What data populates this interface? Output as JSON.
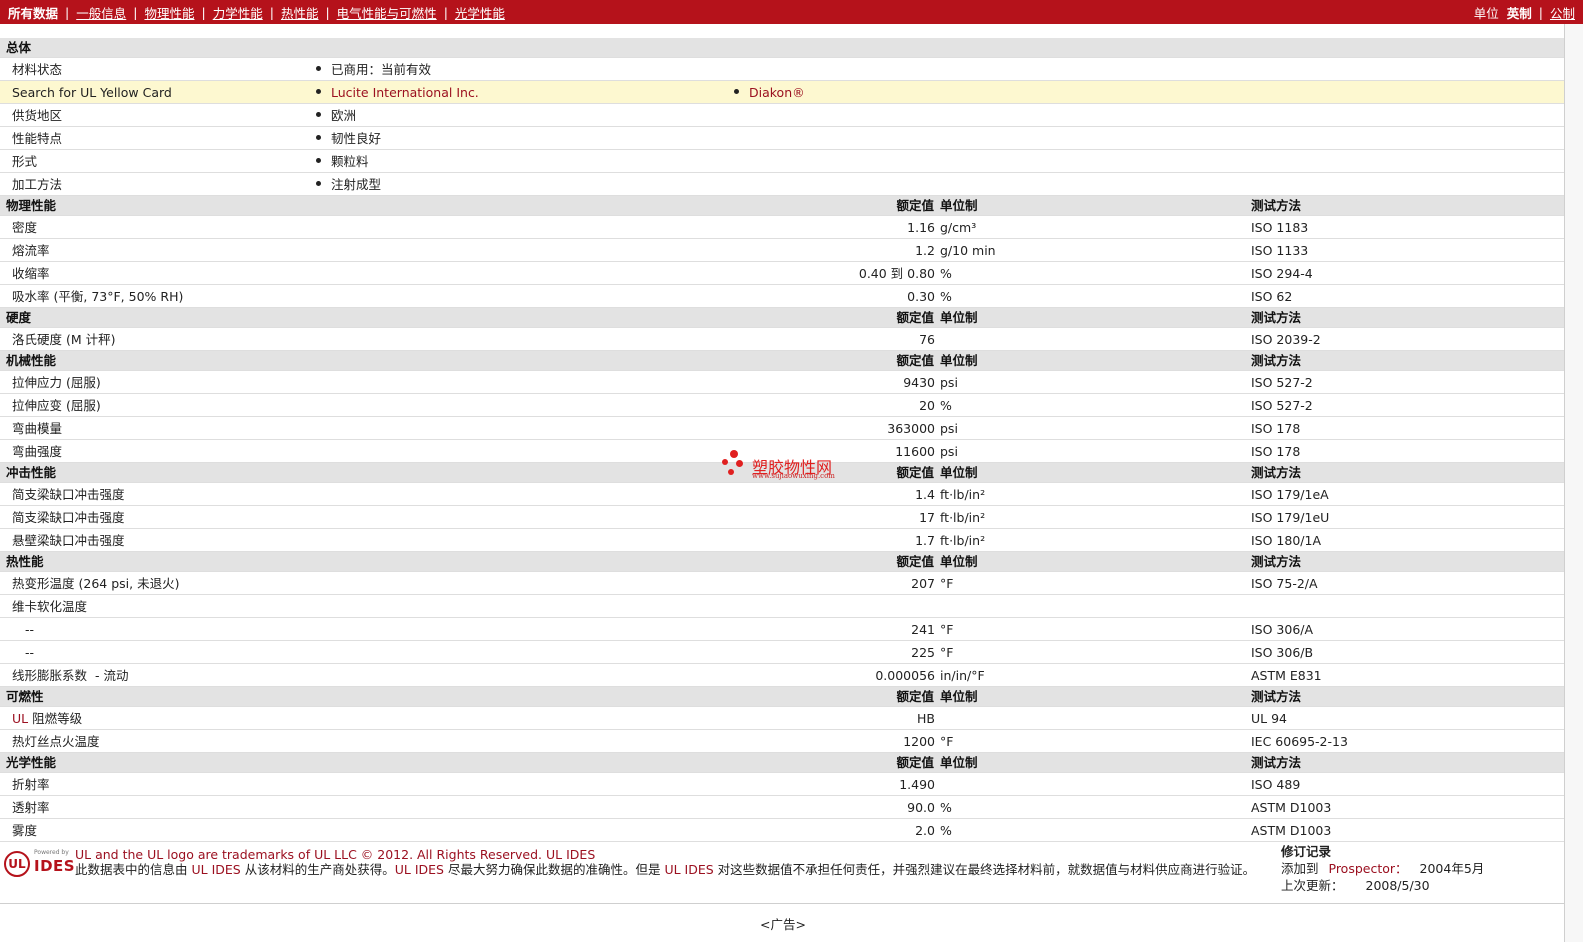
{
  "topbar": {
    "all_data": "所有数据",
    "nav": [
      "一般信息",
      "物理性能",
      "力学性能",
      "热性能",
      "电气性能与可燃性",
      "光学性能"
    ],
    "unit_label": "单位",
    "english": "英制",
    "metric": "公制",
    "sep": "|"
  },
  "general": {
    "title": "总体",
    "rows": [
      {
        "label": "材料状态",
        "v1": "已商用：当前有效",
        "v2": ""
      },
      {
        "label": "Search for UL Yellow Card",
        "v1": "Lucite International Inc.",
        "v2": "Diakon®"
      },
      {
        "label": "供货地区",
        "v1": "欧洲",
        "v2": ""
      },
      {
        "label": "性能特点",
        "v1": "韧性良好",
        "v2": ""
      },
      {
        "label": "形式",
        "v1": "颗粒料",
        "v2": ""
      },
      {
        "label": "加工方法",
        "v1": "注射成型",
        "v2": ""
      }
    ]
  },
  "columns": {
    "value": "额定值",
    "unit": "单位制",
    "test": "测试方法"
  },
  "sections": {
    "physical": {
      "title": "物理性能",
      "rows": [
        {
          "label": "密度",
          "label_extra": "",
          "value": "1.16",
          "unit": "g/cm³",
          "test": "ISO 1183"
        },
        {
          "label": "熔流率",
          "label_extra": "",
          "value": "1.2",
          "unit": "g/10 min",
          "test": "ISO 1133"
        },
        {
          "label": "收缩率",
          "label_extra": "",
          "value": "0.40 到 0.80",
          "unit": "%",
          "test": "ISO 294-4"
        },
        {
          "label": "吸水率",
          "label_extra": "(平衡, 73°F, 50% RH)",
          "value": "0.30",
          "unit": "%",
          "test": "ISO 62"
        }
      ]
    },
    "hardness": {
      "title": "硬度",
      "rows": [
        {
          "label": "洛氏硬度",
          "label_extra": "(M 计秤)",
          "value": "76",
          "unit": "",
          "test": "ISO 2039-2"
        }
      ]
    },
    "mechanical": {
      "title": "机械性能",
      "rows": [
        {
          "label": "拉伸应力",
          "label_extra": "(屈服)",
          "value": "9430",
          "unit": "psi",
          "test": "ISO 527-2"
        },
        {
          "label": "拉伸应变",
          "label_extra": "(屈服)",
          "value": "20",
          "unit": "%",
          "test": "ISO 527-2"
        },
        {
          "label": "弯曲模量",
          "label_extra": "",
          "value": "363000",
          "unit": "psi",
          "test": "ISO 178"
        },
        {
          "label": "弯曲强度",
          "label_extra": "",
          "value": "11600",
          "unit": "psi",
          "test": "ISO 178"
        }
      ]
    },
    "impact": {
      "title": "冲击性能",
      "rows": [
        {
          "label": "简支梁缺口冲击强度",
          "label_extra": "",
          "value": "1.4",
          "unit": "ft·lb/in²",
          "test": "ISO 179/1eA"
        },
        {
          "label": "简支梁缺口冲击强度",
          "label_extra": "",
          "value": "17",
          "unit": "ft·lb/in²",
          "test": "ISO 179/1eU"
        },
        {
          "label": "悬壁梁缺口冲击强度",
          "label_extra": "",
          "value": "1.7",
          "unit": "ft·lb/in²",
          "test": "ISO 180/1A"
        }
      ]
    },
    "thermal": {
      "title": "热性能",
      "rows": [
        {
          "label": "热变形温度",
          "label_extra": "(264 psi, 未退火)",
          "value": "207",
          "unit": "°F",
          "test": "ISO 75-2/A"
        },
        {
          "label": "维卡软化温度",
          "label_extra": "",
          "value": "",
          "unit": "",
          "test": ""
        },
        {
          "label": "--",
          "label_extra": "",
          "value": "241",
          "unit": "°F",
          "test": "ISO 306/A"
        },
        {
          "label": "--",
          "label_extra": "",
          "value": "225",
          "unit": "°F",
          "test": "ISO 306/B"
        },
        {
          "label": "线形膨胀系数",
          "label_extra": " - 流动",
          "value": "0.000056",
          "unit": "in/in/°F",
          "test": "ASTM E831"
        }
      ]
    },
    "flammability": {
      "title": "可燃性",
      "rows": [
        {
          "label": "UL",
          "label_extra": "阻燃等级",
          "value": "HB",
          "unit": "",
          "test": "UL 94"
        },
        {
          "label": "热灯丝点火温度",
          "label_extra": "",
          "value": "1200",
          "unit": "°F",
          "test": "IEC 60695-2-13"
        }
      ]
    },
    "optical": {
      "title": "光学性能",
      "rows": [
        {
          "label": "折射率",
          "label_extra": "",
          "value": "1.490",
          "unit": "",
          "test": "ISO 489"
        },
        {
          "label": "透射率",
          "label_extra": "",
          "value": "90.0",
          "unit": "%",
          "test": "ASTM D1003"
        },
        {
          "label": "雾度",
          "label_extra": "",
          "value": "2.0",
          "unit": "%",
          "test": "ASTM D1003"
        }
      ]
    }
  },
  "watermark": {
    "title": "塑胶物性网",
    "url": "www.sujiaowuxing.com"
  },
  "footer": {
    "logo_ul": "UL",
    "logo_powered": "Powered by",
    "logo_ides": "IDES",
    "trademark": "UL and the UL logo are trademarks of UL LLC © 2012. All Rights Reserved.",
    "trademark_link": "UL IDES",
    "disclaimer_1": "此数据表中的信息由",
    "disclaimer_link1": "UL IDES",
    "disclaimer_2": "从该材料的生产商处获得。",
    "disclaimer_link2": "UL IDES",
    "disclaimer_3": "尽最大努力确保此数据的准确性。但是",
    "disclaimer_link3": "UL IDES",
    "disclaimer_4": "对这些数据值不承担任何责任，并强烈建议在最终选择材料前，就数据值与材料供应商进行验证。",
    "rev_title": "修订记录",
    "added_label": "添加到",
    "added_link": "Prospector：",
    "added_value": "2004年5月",
    "updated_label": "上次更新：",
    "updated_value": "2008/5/30"
  },
  "ad_label": "<广告>"
}
